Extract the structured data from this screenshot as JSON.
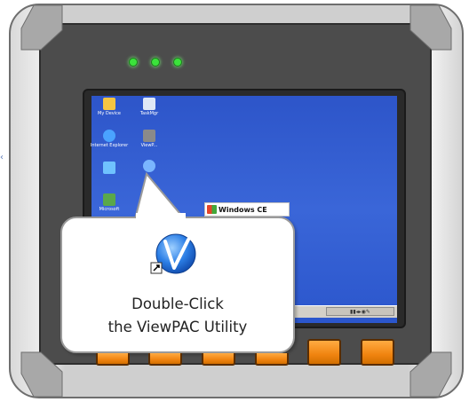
{
  "desktop": {
    "icons": [
      {
        "label": "My Device",
        "icon": "my-device-icon",
        "color": "#f4c542"
      },
      {
        "label": "TaskMgr",
        "icon": "taskmgr-icon",
        "color": "#dfe8f6"
      },
      {
        "label": "Internet Explorer",
        "icon": "internet-explorer-icon",
        "color": "#4aa3ff"
      },
      {
        "label": "ViewP...",
        "icon": "viewpac-app-icon",
        "color": "#8a8a8a"
      },
      {
        "label": "ViewPAC",
        "icon": "viewpac-shortcut-icon",
        "color": "#7ab6ff"
      },
      {
        "label": "Microsoft",
        "icon": "microsoft-icon",
        "color": "#5aa84a"
      }
    ],
    "windows_ce_label": "Windows CE"
  },
  "callout": {
    "line1": "Double-Click",
    "line2": "the ViewPAC Utility",
    "icon": "viewpac-utility-icon"
  },
  "colors": {
    "led": "#3be23b",
    "function_key": "#f08410",
    "desktop": "#2d55c9"
  },
  "function_keys": 6
}
